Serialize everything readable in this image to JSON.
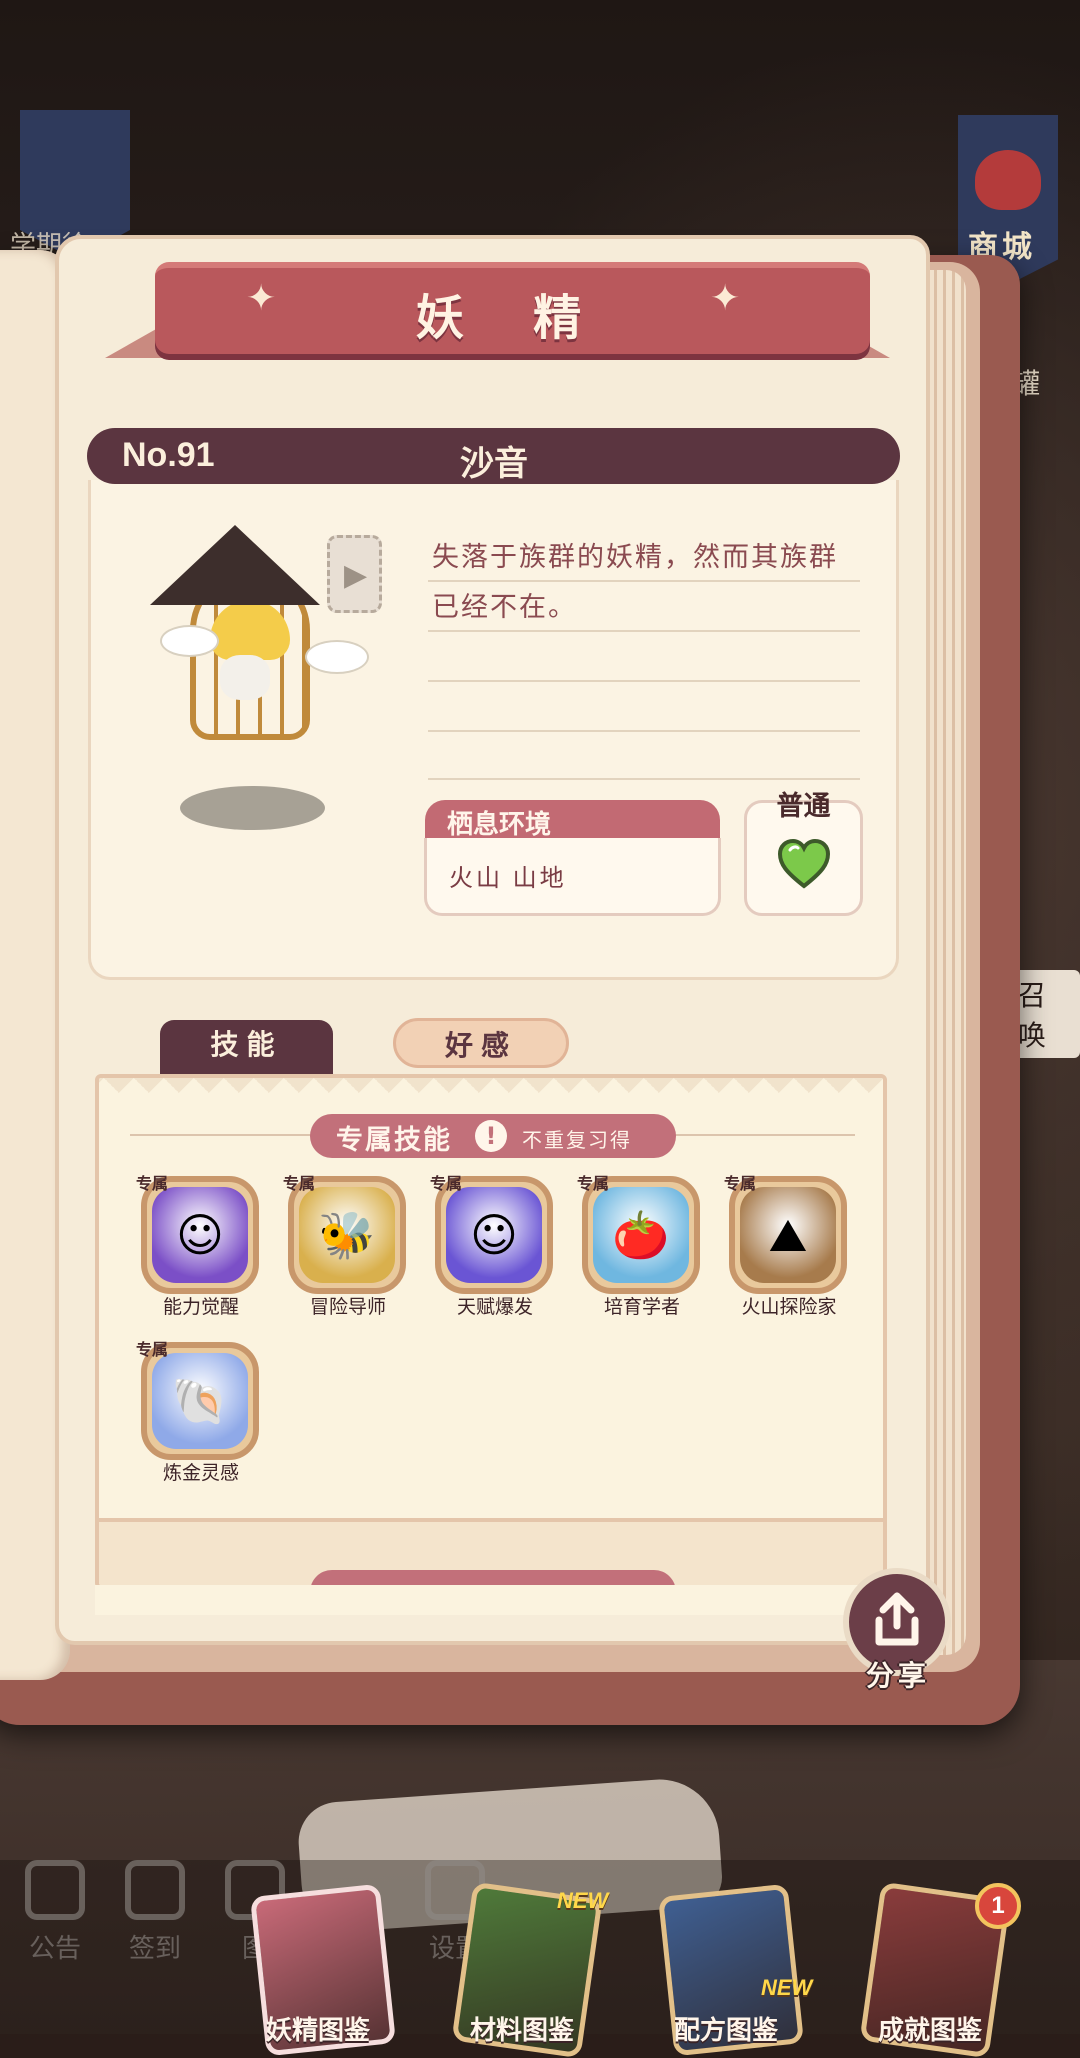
{
  "background": {
    "left_banner_text": "学期徐",
    "shop_label": "商城",
    "jar_label": "罐",
    "summon_label": "召 唤"
  },
  "page_title": "妖 精",
  "creature": {
    "number": "No.91",
    "name": "沙音",
    "description": "失落于族群的妖精，然而其族群已经不在。",
    "habitat_title": "栖息环境",
    "habitat_value": "火山 山地",
    "rarity": "普通",
    "rarity_color": "#7cc94a"
  },
  "tabs": [
    {
      "label": "技能",
      "active": true
    },
    {
      "label": "好感",
      "active": false
    }
  ],
  "exclusive_skills": {
    "title": "专属技能",
    "warning_icon": "!",
    "note": "不重复习得",
    "tag": "专属",
    "items": [
      {
        "name": "能力觉醒",
        "icon": "pink-figure-icon",
        "glyph": "☺",
        "color": "#7b4fc7"
      },
      {
        "name": "冒险导师",
        "icon": "bee-icon",
        "glyph": "🐝",
        "color": "#d9b04d"
      },
      {
        "name": "天赋爆发",
        "icon": "pink-figure-icon",
        "glyph": "☺",
        "color": "#6a55d4"
      },
      {
        "name": "培育学者",
        "icon": "pot-tomato-icon",
        "glyph": "🍅",
        "color": "#6fb7e0"
      },
      {
        "name": "火山探险家",
        "icon": "volcano-explorer-icon",
        "glyph": "⛰",
        "color": "#a77b4c"
      },
      {
        "name": "炼金灵感",
        "icon": "shell-plus-icon",
        "glyph": "🐚",
        "color": "#8fa9e8"
      }
    ]
  },
  "share_label": "分享",
  "bottom_nav": {
    "faded": [
      {
        "label": "公告",
        "icon": "notice-icon"
      },
      {
        "label": "签到",
        "icon": "calendar-check-icon"
      },
      {
        "label": "图",
        "icon": "album-icon"
      },
      {
        "label": "设置",
        "icon": "gear-icon"
      }
    ],
    "dock": [
      {
        "label": "妖精图鉴",
        "icon": "fairy-codex-icon",
        "color": "#c86a78",
        "new": ""
      },
      {
        "label": "材料图鉴",
        "icon": "material-codex-icon",
        "color": "#4f7a3a",
        "new": "NEW"
      },
      {
        "label": "配方图鉴",
        "icon": "recipe-codex-icon",
        "color": "#3f5f92",
        "new": "NEW"
      },
      {
        "label": "成就图鉴",
        "icon": "achievement-codex-icon",
        "color": "#8a3c3c",
        "new": "",
        "badge": "1"
      }
    ]
  }
}
